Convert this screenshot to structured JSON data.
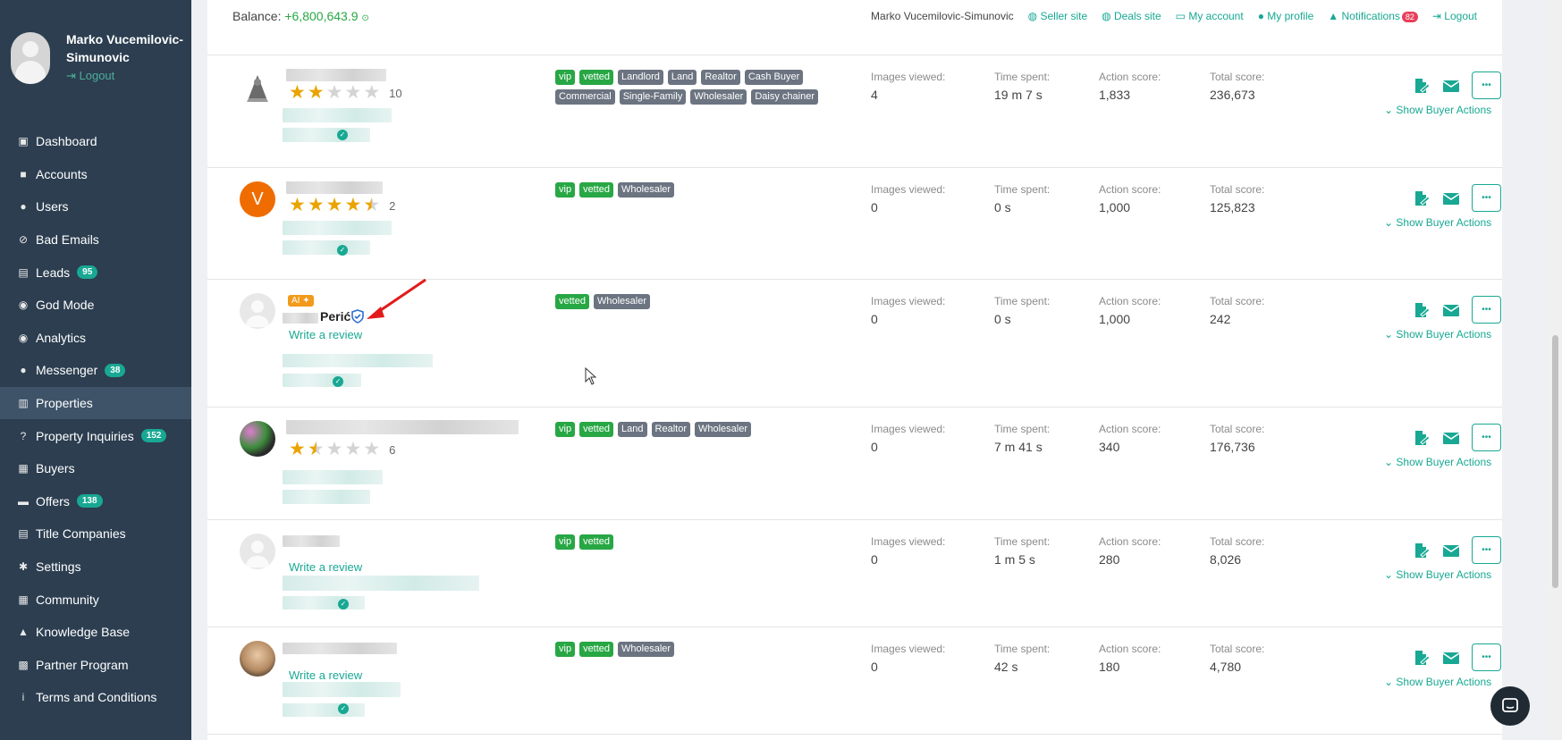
{
  "sidebar": {
    "user_name": "Marko Vucemilovic-Simunovic",
    "logout_label": "Logout",
    "items": [
      {
        "label": "Dashboard",
        "icon": "dashboard-icon",
        "glyph": "▣"
      },
      {
        "label": "Accounts",
        "icon": "briefcase-icon",
        "glyph": "■"
      },
      {
        "label": "Users",
        "icon": "user-icon",
        "glyph": "●"
      },
      {
        "label": "Bad Emails",
        "icon": "ban-icon",
        "glyph": "⊘"
      },
      {
        "label": "Leads",
        "icon": "id-card-icon",
        "glyph": "▤",
        "badge": "95"
      },
      {
        "label": "God Mode",
        "icon": "globe-icon",
        "glyph": "◉"
      },
      {
        "label": "Analytics",
        "icon": "globe-icon",
        "glyph": "◉"
      },
      {
        "label": "Messenger",
        "icon": "chat-icon",
        "glyph": "●",
        "badge": "38"
      },
      {
        "label": "Properties",
        "icon": "building-icon",
        "glyph": "▥",
        "active": true
      },
      {
        "label": "Property Inquiries",
        "icon": "question-icon",
        "glyph": "?",
        "badge": "152"
      },
      {
        "label": "Buyers",
        "icon": "users-icon",
        "glyph": "▦"
      },
      {
        "label": "Offers",
        "icon": "handshake-icon",
        "glyph": "▬",
        "badge": "138"
      },
      {
        "label": "Title Companies",
        "icon": "document-icon",
        "glyph": "▤"
      },
      {
        "label": "Settings",
        "icon": "gear-icon",
        "glyph": "✱"
      },
      {
        "label": "Community",
        "icon": "people-icon",
        "glyph": "▦"
      },
      {
        "label": "Knowledge Base",
        "icon": "graduation-icon",
        "glyph": "▲"
      },
      {
        "label": "Partner Program",
        "icon": "partner-icon",
        "glyph": "▩"
      },
      {
        "label": "Terms and Conditions",
        "icon": "info-icon",
        "glyph": "i"
      }
    ]
  },
  "topbar": {
    "balance_label": "Balance:",
    "balance_value": "+6,800,643.9",
    "user_name": "Marko Vucemilovic-Simunovic",
    "seller_site": "Seller site",
    "deals_site": "Deals site",
    "my_account": "My account",
    "my_profile": "My profile",
    "notifications": "Notifications",
    "notifications_count": "82",
    "logout": "Logout"
  },
  "labels": {
    "images_viewed": "Images viewed:",
    "time_spent": "Time spent:",
    "action_score": "Action score:",
    "total_score": "Total score:",
    "show_buyer_actions": "Show Buyer Actions",
    "write_review": "Write a review",
    "ai_badge": "AI ✦"
  },
  "buyers": [
    {
      "rating": 2,
      "reviews": "10",
      "tags": [
        "vip",
        "vetted",
        "Landlord",
        "Land",
        "Realtor",
        "Cash Buyer",
        "Commercial",
        "Single-Family",
        "Wholesaler",
        "Daisy chainer"
      ],
      "images_viewed": "4",
      "time_spent": "19 m 7 s",
      "action_score": "1,833",
      "total_score": "236,673"
    },
    {
      "avatar_letter": "V",
      "rating": 4.5,
      "reviews": "2",
      "tags": [
        "vip",
        "vetted",
        "Wholesaler"
      ],
      "images_viewed": "0",
      "time_spent": "0 s",
      "action_score": "1,000",
      "total_score": "125,823"
    },
    {
      "name": "Perić",
      "tags": [
        "vetted",
        "Wholesaler"
      ],
      "images_viewed": "0",
      "time_spent": "0 s",
      "action_score": "1,000",
      "total_score": "242"
    },
    {
      "rating": 1.5,
      "reviews": "6",
      "tags": [
        "vip",
        "vetted",
        "Land",
        "Realtor",
        "Wholesaler"
      ],
      "images_viewed": "0",
      "time_spent": "7 m 41 s",
      "action_score": "340",
      "total_score": "176,736"
    },
    {
      "tags": [
        "vip",
        "vetted"
      ],
      "images_viewed": "0",
      "time_spent": "1 m 5 s",
      "action_score": "280",
      "total_score": "8,026"
    },
    {
      "tags": [
        "vip",
        "vetted",
        "Wholesaler"
      ],
      "images_viewed": "0",
      "time_spent": "42 s",
      "action_score": "180",
      "total_score": "4,780"
    }
  ]
}
